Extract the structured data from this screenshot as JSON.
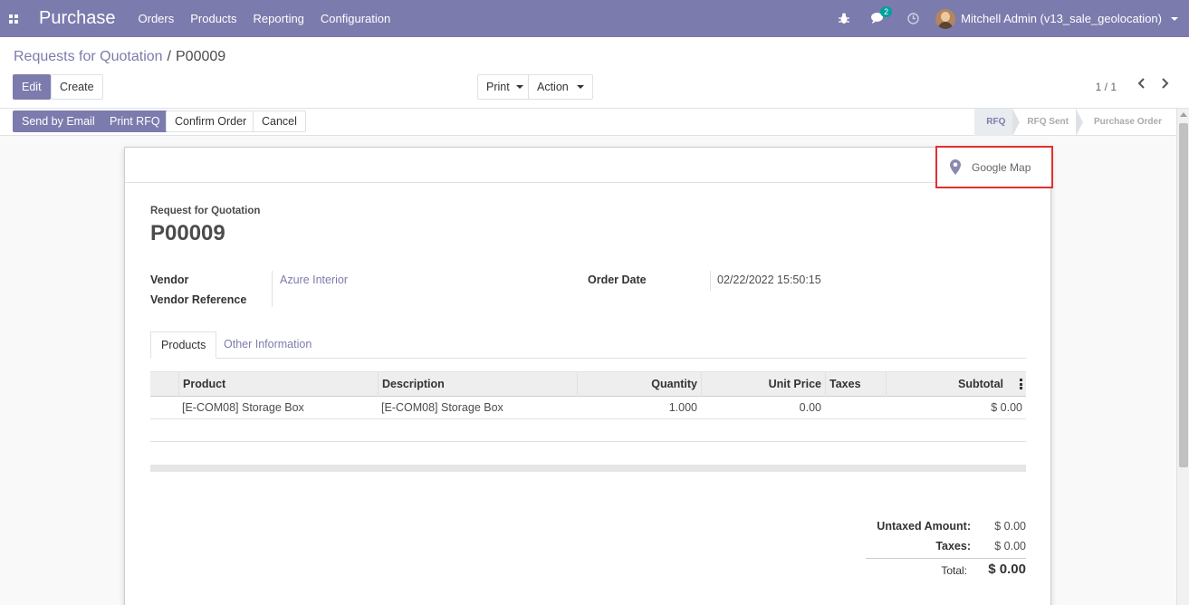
{
  "navbar": {
    "app_name": "Purchase",
    "menu": [
      "Orders",
      "Products",
      "Reporting",
      "Configuration"
    ],
    "message_count": "2",
    "user_name": "Mitchell Admin (v13_sale_geolocation)",
    "color": "#7c7bad"
  },
  "breadcrumb": {
    "parent": "Requests for Quotation",
    "current": "P00009"
  },
  "actions": {
    "edit": "Edit",
    "create": "Create",
    "print": "Print",
    "action": "Action",
    "pager": "1 / 1"
  },
  "status_buttons": {
    "send_email": "Send by Email",
    "print_rfq": "Print RFQ",
    "confirm": "Confirm Order",
    "cancel": "Cancel"
  },
  "status_steps": [
    "RFQ",
    "RFQ Sent",
    "Purchase Order"
  ],
  "status_active": "RFQ",
  "smart_button": {
    "label": "Google Map",
    "icon": "map-marker-icon"
  },
  "document": {
    "type": "Request for Quotation",
    "name": "P00009",
    "vendor_label": "Vendor",
    "vendor_value": "Azure Interior",
    "vendor_ref_label": "Vendor Reference",
    "order_date_label": "Order Date",
    "order_date_value": "02/22/2022 15:50:15"
  },
  "tabs": [
    "Products",
    "Other Information"
  ],
  "order_lines": {
    "columns": [
      "Product",
      "Description",
      "Quantity",
      "Unit Price",
      "Taxes",
      "Subtotal"
    ],
    "rows": [
      {
        "product": "[E-COM08] Storage Box",
        "description": "[E-COM08] Storage Box",
        "quantity": "1.000",
        "unit_price": "0.00",
        "taxes": "",
        "subtotal": "$ 0.00"
      }
    ]
  },
  "totals": {
    "untaxed_label": "Untaxed Amount:",
    "untaxed_value": "$ 0.00",
    "taxes_label": "Taxes:",
    "taxes_value": "$ 0.00",
    "total_label": "Total:",
    "total_value": "$ 0.00"
  }
}
